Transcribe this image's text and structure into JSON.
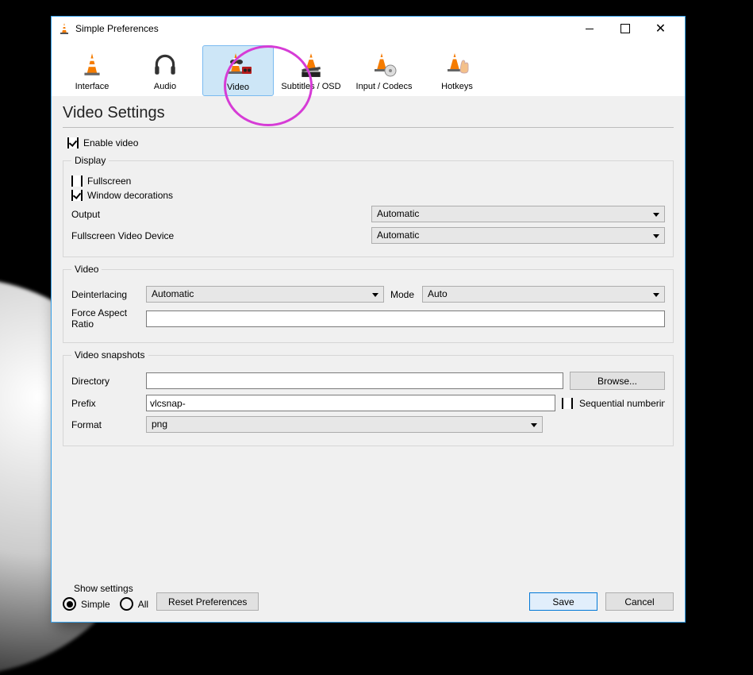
{
  "window": {
    "title": "Simple Preferences"
  },
  "tabs": {
    "interface": "Interface",
    "audio": "Audio",
    "video": "Video",
    "subtitles": "Subtitles / OSD",
    "input": "Input / Codecs",
    "hotkeys": "Hotkeys",
    "selected": "video"
  },
  "section_heading": "Video Settings",
  "toplevel": {
    "enable_video": "Enable video"
  },
  "display": {
    "legend": "Display",
    "fullscreen": "Fullscreen",
    "window_decorations": "Window decorations",
    "output_label": "Output",
    "output_value": "Automatic",
    "fs_device_label": "Fullscreen Video Device",
    "fs_device_value": "Automatic"
  },
  "video": {
    "legend": "Video",
    "deint_label": "Deinterlacing",
    "deint_value": "Automatic",
    "mode_label": "Mode",
    "mode_value": "Auto",
    "far_label": "Force Aspect Ratio",
    "far_value": ""
  },
  "snapshots": {
    "legend": "Video snapshots",
    "directory_label": "Directory",
    "directory_value": "",
    "browse": "Browse...",
    "prefix_label": "Prefix",
    "prefix_value": "vlcsnap-",
    "sequential": "Sequential numbering",
    "format_label": "Format",
    "format_value": "png"
  },
  "footer": {
    "show_settings": "Show settings",
    "simple": "Simple",
    "all": "All",
    "reset": "Reset Preferences",
    "save": "Save",
    "cancel": "Cancel"
  }
}
